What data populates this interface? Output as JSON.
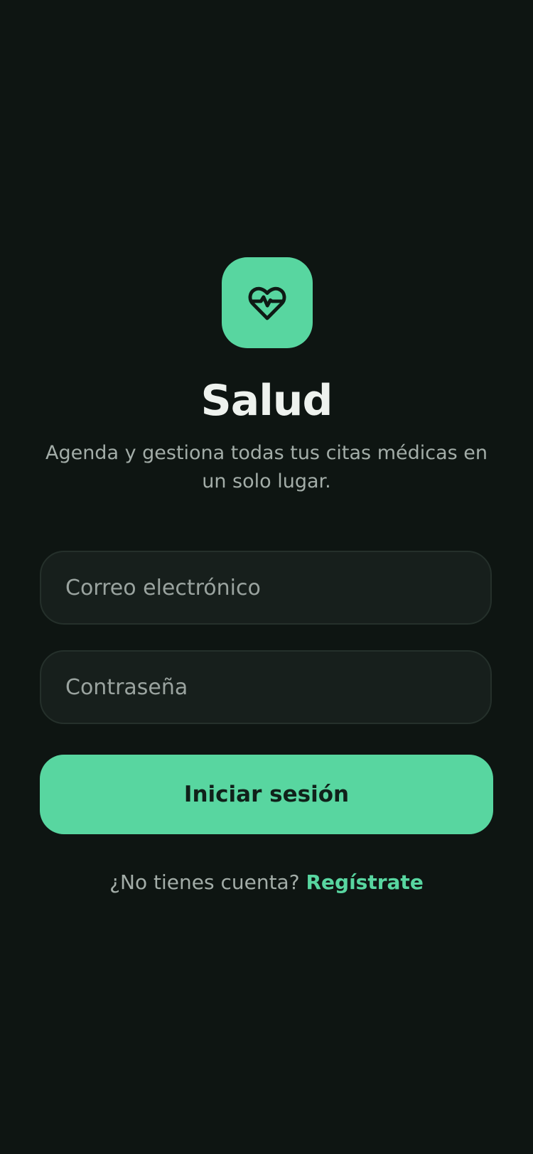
{
  "colors": {
    "background": "#0e1512",
    "accent": "#58d6a0",
    "field_background": "#171f1c",
    "muted_text": "#a3ada8",
    "title_text": "#eef2ee"
  },
  "app": {
    "logo_icon": "heart-pulse-icon",
    "title": "Salud",
    "subtitle": "Agenda y gestiona todas tus citas médicas en un solo lugar."
  },
  "form": {
    "email": {
      "placeholder": "Correo electrónico",
      "value": ""
    },
    "password": {
      "placeholder": "Contraseña",
      "value": ""
    },
    "submit_label": "Iniciar sesión"
  },
  "signup": {
    "prompt": "¿No tienes cuenta?",
    "link_label": "Regístrate"
  }
}
